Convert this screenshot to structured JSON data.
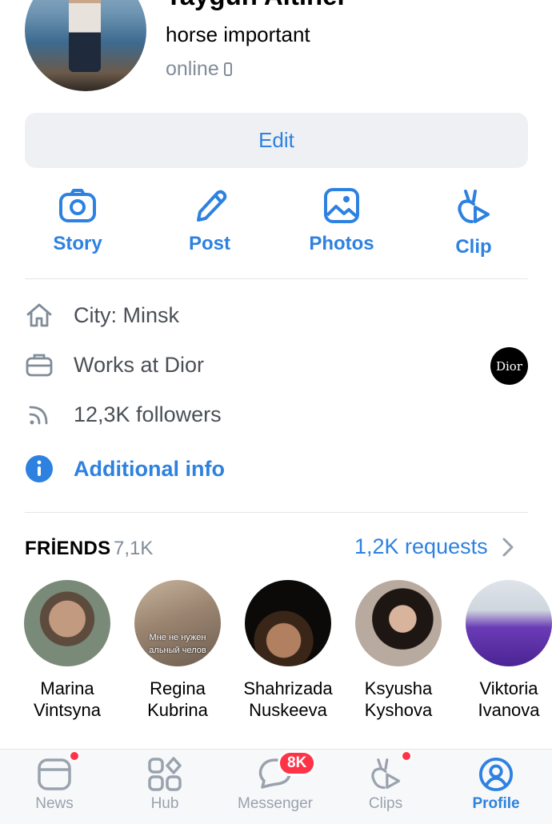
{
  "profile": {
    "name": "Taygun Altıner",
    "status": "horse important",
    "online": "online"
  },
  "edit_button": "Edit",
  "actions": [
    {
      "label": "Story",
      "icon": "camera-icon"
    },
    {
      "label": "Post",
      "icon": "pencil-icon"
    },
    {
      "label": "Photos",
      "icon": "image-icon"
    },
    {
      "label": "Clip",
      "icon": "clip-icon"
    }
  ],
  "info": {
    "city": "City: Minsk",
    "work": "Works at Dior",
    "work_logo": "Dior",
    "followers": "12,3K followers",
    "additional": "Additional info"
  },
  "friends": {
    "title": "FRİENDS",
    "count": "7,1K",
    "requests": "1,2K requests",
    "list": [
      {
        "name": "Marina Vintsyna"
      },
      {
        "name": "Regina Kubrina",
        "photo_caption": "Мне не нужен альный челов"
      },
      {
        "name": "Shahrizada Nuskeeva"
      },
      {
        "name": "Ksyusha Kyshova"
      },
      {
        "name": "Viktoria Ivanova"
      }
    ]
  },
  "tabs": [
    {
      "label": "News"
    },
    {
      "label": "Hub"
    },
    {
      "label": "Messenger",
      "badge": "8K"
    },
    {
      "label": "Clips"
    },
    {
      "label": "Profile"
    }
  ],
  "colors": {
    "accent": "#2d81e0",
    "secondary_text": "#818c99",
    "badge": "#ff3347"
  }
}
